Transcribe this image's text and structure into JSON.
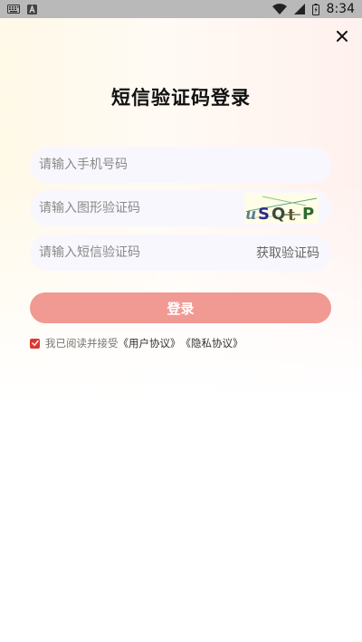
{
  "status_bar": {
    "time": "8:34",
    "left_icons": [
      "keyboard-icon",
      "a-app-icon"
    ],
    "right_icons": [
      "wifi-icon",
      "signal-icon",
      "battery-icon"
    ]
  },
  "header": {
    "close_icon": "close-icon",
    "title": "短信验证码登录"
  },
  "form": {
    "phone_placeholder": "请输入手机号码",
    "captcha_placeholder": "请输入图形验证码",
    "captcha_text": "uSQtP",
    "sms_placeholder": "请输入短信验证码",
    "get_code_label": "获取验证码",
    "login_label": "登录"
  },
  "agreement": {
    "checked": true,
    "prefix": "我已阅读并接受",
    "user_agreement": "《用户协议》",
    "privacy_policy": "《隐私协议》"
  },
  "colors": {
    "accent": "#d93a32",
    "login_button": "#f09a93",
    "input_bg": "#f8f7fd"
  }
}
